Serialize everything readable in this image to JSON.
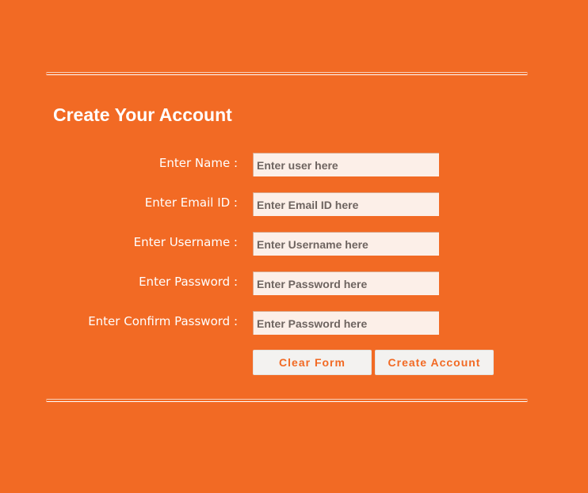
{
  "colors": {
    "background": "#f26a24",
    "input_background": "#fcefe8",
    "button_background": "#f3f2f0",
    "button_text": "#f26a24",
    "label_text": "#ffffff"
  },
  "form": {
    "title": "Create Your Account",
    "fields": [
      {
        "label": "Enter Name :",
        "placeholder": "Enter user here",
        "value": ""
      },
      {
        "label": "Enter Email ID :",
        "placeholder": "Enter Email ID here",
        "value": ""
      },
      {
        "label": "Enter Username :",
        "placeholder": "Enter Username here",
        "value": ""
      },
      {
        "label": "Enter Password :",
        "placeholder": "Enter Password here",
        "value": ""
      },
      {
        "label": "Enter Confirm Password :",
        "placeholder": "Enter Password here",
        "value": ""
      }
    ],
    "buttons": {
      "clear_label": "Clear Form",
      "create_label": "Create Account"
    }
  }
}
